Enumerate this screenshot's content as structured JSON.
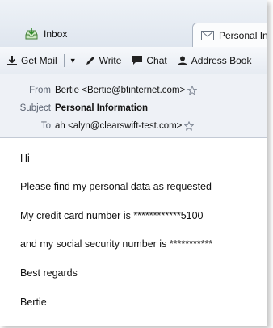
{
  "tabs": {
    "inbox": "Inbox",
    "message": "Personal In"
  },
  "toolbar": {
    "get_mail": "Get Mail",
    "write": "Write",
    "chat": "Chat",
    "address_book": "Address Book"
  },
  "headers": {
    "from_label": "From",
    "from_value": "Bertie <Bertie@btinternet.com>",
    "subject_label": "Subject",
    "subject_value": "Personal Information",
    "to_label": "To",
    "to_value": "ah <alyn@clearswift-test.com>"
  },
  "body": {
    "line1": "Hi",
    "line2": "Please find my personal data as requested",
    "line3": "My credit card number is ************5100",
    "line4": "and my social security number is ***********",
    "line5": "Best regards",
    "line6": "Bertie"
  },
  "colors": {
    "accent": "#3a6ea5",
    "toolbar_bg": "#e6ebf2",
    "header_bg": "#eef1f6"
  }
}
